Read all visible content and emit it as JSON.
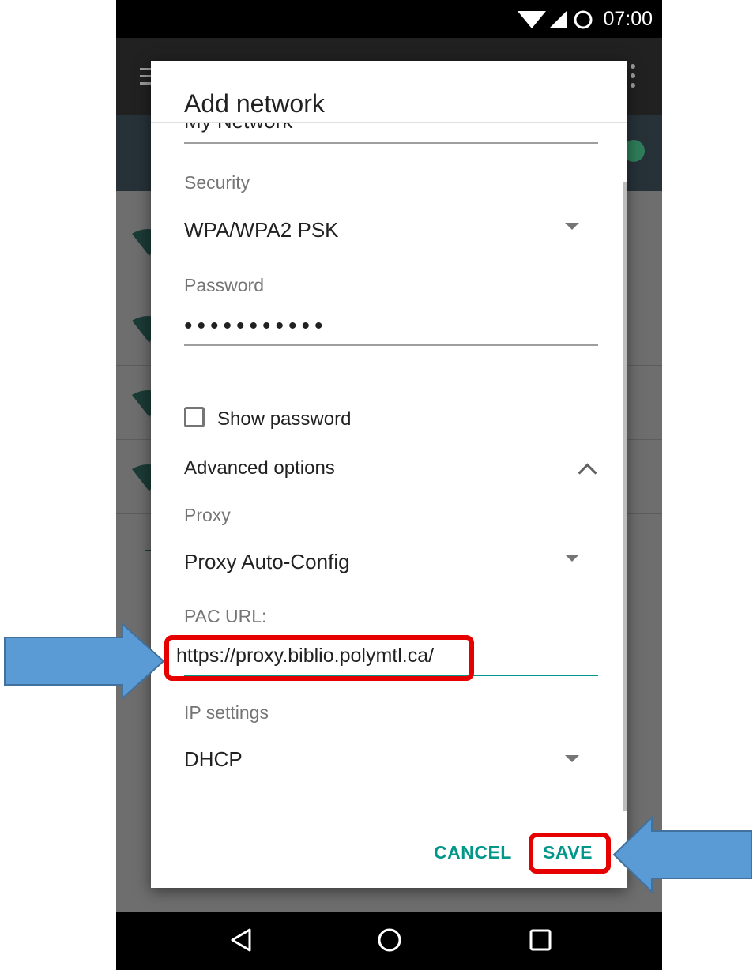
{
  "status_bar": {
    "time": "07:00",
    "icons": [
      "wifi-icon",
      "cell-signal-icon",
      "ring-icon"
    ]
  },
  "dialog": {
    "title": "Add network",
    "network_name": {
      "value": "My Network"
    },
    "security": {
      "label": "Security",
      "value": "WPA/WPA2 PSK"
    },
    "password": {
      "label": "Password",
      "value": "•••••••••••"
    },
    "show_password": {
      "label": "Show password",
      "checked": false
    },
    "advanced_options": {
      "label": "Advanced options",
      "expanded": true
    },
    "proxy": {
      "label": "Proxy",
      "value": "Proxy Auto-Config"
    },
    "pac_url": {
      "label": "PAC URL:",
      "value": "https://proxy.biblio.polymtl.ca/"
    },
    "ip_settings": {
      "label": "IP settings",
      "value": "DHCP"
    },
    "buttons": {
      "cancel": "CANCEL",
      "save": "SAVE"
    }
  },
  "annotations": {
    "highlight_color": "#e60000",
    "arrow_color": "#5b9bd5",
    "highlighted": [
      "pac-url-field",
      "save-button"
    ]
  },
  "colors": {
    "accent": "#009688",
    "status_bar": "#000000",
    "app_bar": "#212121"
  }
}
